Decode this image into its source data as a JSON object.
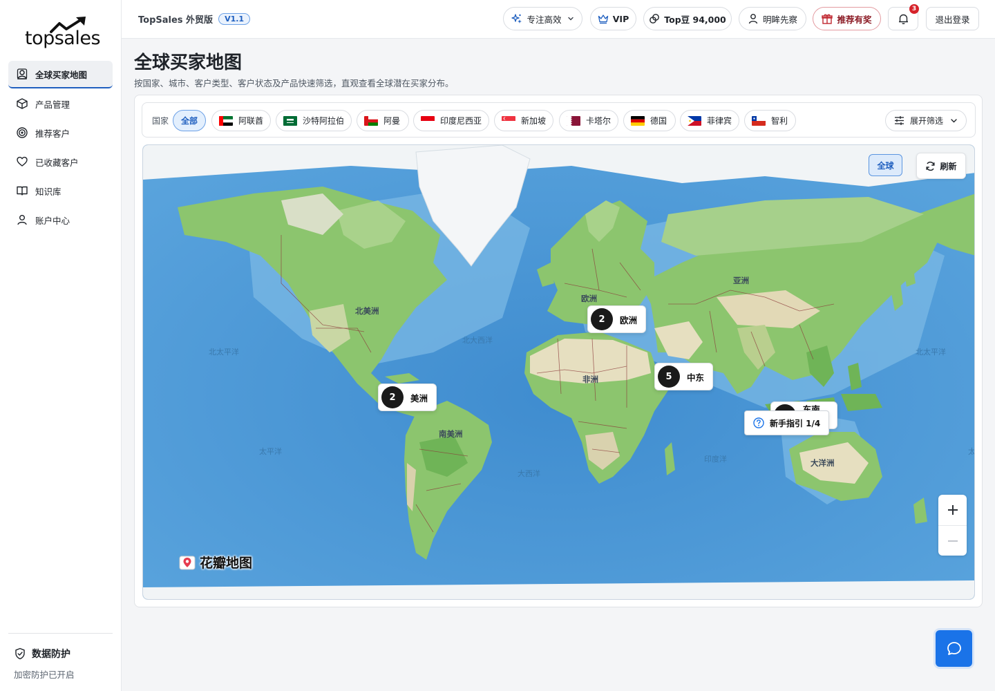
{
  "app": {
    "logo_text": "topsales",
    "brand": "TopSales 外贸版",
    "version": "V1.1"
  },
  "sidebar": {
    "items": [
      {
        "label": "全球买家地图",
        "icon": "map-pin-person-icon",
        "active": true
      },
      {
        "label": "产品管理",
        "icon": "box-icon"
      },
      {
        "label": "推荐客户",
        "icon": "target-icon"
      },
      {
        "label": "已收藏客户",
        "icon": "heart-icon"
      },
      {
        "label": "知识库",
        "icon": "book-icon"
      },
      {
        "label": "账户中心",
        "icon": "user-icon"
      }
    ],
    "protect_title": "数据防护",
    "protect_status": "加密防护已开启"
  },
  "topbar": {
    "focus_label": "专注高效",
    "vip_label": "VIP",
    "topdou_label": "Top豆 94,000",
    "user_label": "明眸先察",
    "referral_label": "推荐有奖",
    "notification_count": "3",
    "logout_label": "退出登录"
  },
  "page": {
    "title": "全球买家地图",
    "subtitle": "按国家、城市、客户类型、客户状态及产品快速筛选，直观查看全球潜在买家分布。"
  },
  "filter": {
    "label": "国家",
    "all_label": "全部",
    "countries": [
      {
        "name": "阿联酋",
        "flag": "uae"
      },
      {
        "name": "沙特阿拉伯",
        "flag": "saudi"
      },
      {
        "name": "阿曼",
        "flag": "oman"
      },
      {
        "name": "印度尼西亚",
        "flag": "indonesia"
      },
      {
        "name": "新加坡",
        "flag": "singapore"
      },
      {
        "name": "卡塔尔",
        "flag": "qatar"
      },
      {
        "name": "德国",
        "flag": "germany"
      },
      {
        "name": "菲律宾",
        "flag": "philippines"
      },
      {
        "name": "智利",
        "flag": "chile"
      }
    ],
    "expand_label": "展开筛选"
  },
  "map": {
    "global_label": "全球",
    "refresh_label": "刷新",
    "attribution": "花瓣地图",
    "clusters": [
      {
        "count": "2",
        "region": "欧洲"
      },
      {
        "count": "5",
        "region": "中东"
      },
      {
        "count": "2",
        "region": "美洲"
      }
    ],
    "guide_label": "新手指引 1/4",
    "hidden_cluster_region": "东南亚",
    "continent_labels": {
      "north_america": "北美洲",
      "south_america": "南美洲",
      "europe": "欧洲",
      "africa": "非洲",
      "asia": "亚洲",
      "oceania": "大洋洲"
    },
    "ocean_labels": {
      "north_pacific_left": "北太平洋",
      "north_pacific_right": "北太平洋",
      "north_atlantic": "北大西洋",
      "pacific": "太平洋",
      "atlantic": "大西洋",
      "indian": "印度洋",
      "pacific_edge": "太"
    },
    "colors": {
      "ocean": "#4f9bd8",
      "land": "#8cc56e",
      "desert": "#e6dfc0",
      "ice": "#f4f6f8",
      "border": "#8b3a3a"
    }
  }
}
